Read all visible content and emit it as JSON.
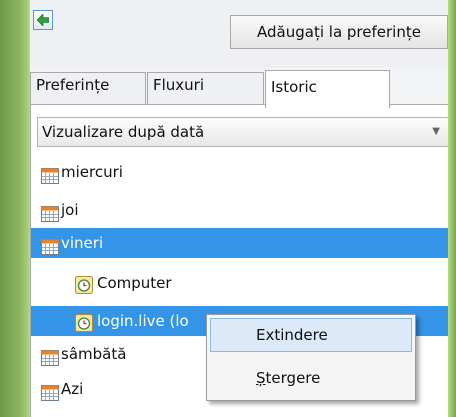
{
  "toolbar": {
    "back_icon": "green-back-arrow-icon",
    "add_to_favorites_label": "Adăugați la preferințe"
  },
  "tabs": [
    {
      "label": "Preferințe",
      "active": false
    },
    {
      "label": "Fluxuri",
      "active": false
    },
    {
      "label": "Istoric",
      "active": true
    }
  ],
  "view_dropdown": {
    "selected": "Vizualizare după dată"
  },
  "history": [
    {
      "label": "miercuri",
      "icon": "calendar-icon",
      "level": 0,
      "selected": false
    },
    {
      "label": "joi",
      "icon": "calendar-icon",
      "level": 0,
      "selected": false
    },
    {
      "label": "vineri",
      "icon": "calendar-icon",
      "level": 0,
      "selected": true
    },
    {
      "label": "Computer",
      "icon": "history-page-icon",
      "level": 1,
      "selected": false
    },
    {
      "label": "login.live (login.live.com)",
      "visible_label": "login.live (lo",
      "icon": "history-page-icon",
      "level": 1,
      "selected": true
    },
    {
      "label": "sâmbătă",
      "icon": "calendar-icon",
      "level": 0,
      "selected": false
    },
    {
      "label": "Azi",
      "icon": "calendar-icon",
      "level": 0,
      "selected": false
    }
  ],
  "context_menu": {
    "items": [
      {
        "label": "Extindere",
        "highlighted": true
      },
      {
        "label": "Ștergere",
        "highlighted": false,
        "accel_letter": "Ș",
        "rest": "tergere"
      }
    ]
  },
  "colors": {
    "selection": "#3394e8",
    "menu_highlight": "#dbe9f8"
  }
}
